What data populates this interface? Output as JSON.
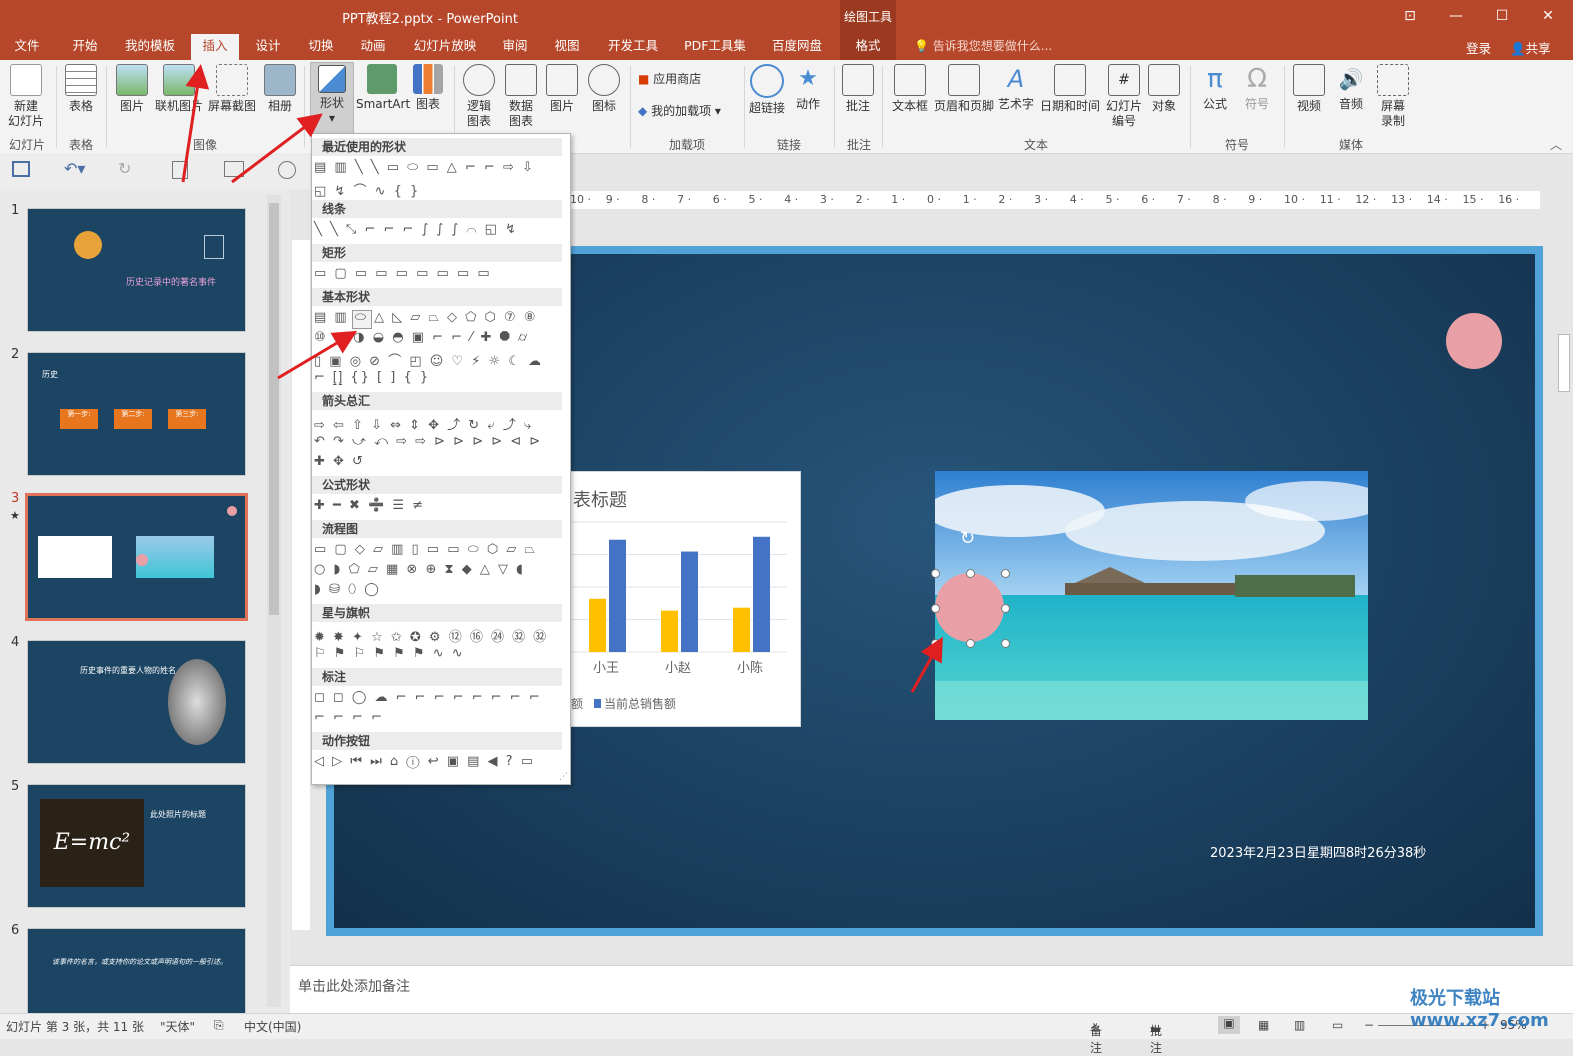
{
  "window": {
    "title": "PPT教程2.pptx - PowerPoint",
    "context_tools_label": "绘图工具",
    "controls": [
      "⊡",
      "—",
      "☐",
      "✕"
    ]
  },
  "tabs": [
    "文件",
    "开始",
    "我的模板",
    "插入",
    "设计",
    "切换",
    "动画",
    "幻灯片放映",
    "审阅",
    "视图",
    "开发工具",
    "PDF工具集",
    "百度网盘",
    "格式"
  ],
  "tellme": "告诉我您想要做什么...",
  "login": "登录",
  "share": "共享",
  "ribbon": {
    "new_slide": "新建\n幻灯片",
    "table": "表格",
    "picture": "图片",
    "online_picture": "联机图片",
    "screenshot": "屏幕截图",
    "album": "相册",
    "shapes": "形状",
    "smartart": "SmartArt",
    "chart": "图表",
    "logic_chart": "逻辑\n图表",
    "data_chart": "数据\n图表",
    "picture2": "图片",
    "icon": "图标",
    "app_store": "应用商店",
    "my_addins": "我的加载项",
    "hyperlink": "超链接",
    "action": "动作",
    "comment": "批注",
    "textbox": "文本框",
    "header_footer": "页眉和页脚",
    "wordart": "艺术字",
    "datetime": "日期和时间",
    "slide_number": "幻灯片\n编号",
    "object": "对象",
    "equation": "公式",
    "symbol": "符号",
    "video": "视频",
    "audio": "音频",
    "screen_record": "屏幕\n录制",
    "groups": {
      "slides": "幻灯片",
      "tables": "表格",
      "images": "图像",
      "addins": "加载项",
      "links": "链接",
      "comments": "批注",
      "text": "文本",
      "symbols": "符号",
      "media": "媒体"
    }
  },
  "dropdown": {
    "sections": [
      {
        "title": "最近使用的形状",
        "rows": [
          "▤ ▥ ╲ ╲ ▭ ⬭ ▭ △ ⌐ ⌐ ⇨ ⇩",
          "◱ ↯ ⌒ ∿ { }"
        ]
      },
      {
        "title": "线条",
        "rows": [
          "╲ ╲ ⤡ ⌐ ⌐ ⌐ ∫ ∫ ∫ ⌒ ◱ ↯"
        ]
      },
      {
        "title": "矩形",
        "rows": [
          "▭ ▢ ▭ ▭ ▭ ▭ ▭ ▭ ▭"
        ]
      },
      {
        "title": "基本形状",
        "rows": [
          "▤ ▥ ⬭ △ ◺ ▱ ⏢ ◇ ⬠ ⬡ ⑦ ⑧",
          "⑩ ◔ ◑ ◒ ◓ ▣ ⌐ ⌐ ⁄ ✚ ⯃ ⌭",
          "▯ ▣ ◎ ⊘ ⌒ ◰ ☺ ♡ ⚡ ☼ ☾ ☁",
          "⌐ ⦋⦌ {} [ ] { }"
        ]
      },
      {
        "title": "箭头总汇",
        "rows": [
          "⇨ ⇦ ⇧ ⇩ ⇔ ⇕ ✥ ⤴ ↻ ⤶ ⤴ ⤷",
          "↶ ↷ ⤻ ⤺ ⇨ ⇨ ⊳ ⊳ ⊳ ⊳ ⊲ ⊳",
          "✚ ✥ ↺"
        ]
      },
      {
        "title": "公式形状",
        "rows": [
          "✚ ━ ✖ ➗ ☰ ≠"
        ]
      },
      {
        "title": "流程图",
        "rows": [
          "▭ ▢ ◇ ▱ ▥ ▯ ▭ ▭ ⬭ ⬡ ▱ ⏢",
          "○ ◗ ⬠ ▱ ▦ ⊗ ⊕ ⧗ ◆ △ ▽ ◖",
          "◗ ⛁ ⬯ ◯"
        ]
      },
      {
        "title": "星与旗帜",
        "rows": [
          "✹ ✸ ✦ ☆ ✩ ✪ ⚙ ⑫ ⑯ ㉔ ㉜ ㉜",
          "⚐ ⚑ ⚐ ⚑ ⚑ ⚑ ∿ ∿"
        ]
      },
      {
        "title": "标注",
        "rows": [
          "◻ ◻ ◯ ☁ ⌐ ⌐ ⌐ ⌐ ⌐ ⌐ ⌐ ⌐",
          "⌐ ⌐ ⌐ ⌐"
        ]
      },
      {
        "title": "动作按钮",
        "rows": [
          "◁ ▷ ⏮ ⏭ ⌂ ⓘ ↩ ▣ ▤ ◀ ? ▭"
        ]
      }
    ]
  },
  "slides": {
    "numbers": [
      "1",
      "2",
      "3",
      "4",
      "5",
      "6"
    ],
    "selected_marker": "★",
    "thumb1_title": "历史记录中的著名事件",
    "thumb2_label": "历史",
    "thumb2_steps": [
      "第一步:",
      "第二步:",
      "第三步:"
    ],
    "thumb4_title": "历史事件的重要人物的姓名",
    "thumb5_title": "此处照片的标题",
    "thumb5_formula": "E=mc²",
    "thumb6_text": "该事件的名言，或支持你的论文或声明语句的一般引述。"
  },
  "canvas": {
    "chart_title": "表标题",
    "date_text": "2023年2月23日星期四8时26分38秒"
  },
  "chart_data": {
    "type": "bar",
    "title": "表标题",
    "categories": [
      "小王",
      "小赵",
      "小陈"
    ],
    "series": [
      {
        "name": "",
        "values": [
          0.9,
          0.7,
          0.75
        ],
        "color": "#ffc000"
      },
      {
        "name": "当前总销售额",
        "values": [
          1.9,
          1.7,
          1.95
        ],
        "color": "#4472c4"
      }
    ],
    "legend_partial": "额",
    "legend_full": "当前总销售额"
  },
  "notes": {
    "placeholder": "单击此处添加备注"
  },
  "status": {
    "slide_info": "幻灯片 第 3 张，共 11 张",
    "theme": "\"天体\"",
    "language": "中文(中国)",
    "notes_btn": "备注",
    "comments_btn": "批注",
    "zoom": "95%"
  },
  "watermark": "极光下载站 www.xz7.com",
  "colors": {
    "accent": "#b7472a",
    "slide_bg": "#1c4563",
    "pink": "#e8a0a6",
    "arrow": "#e02020"
  }
}
